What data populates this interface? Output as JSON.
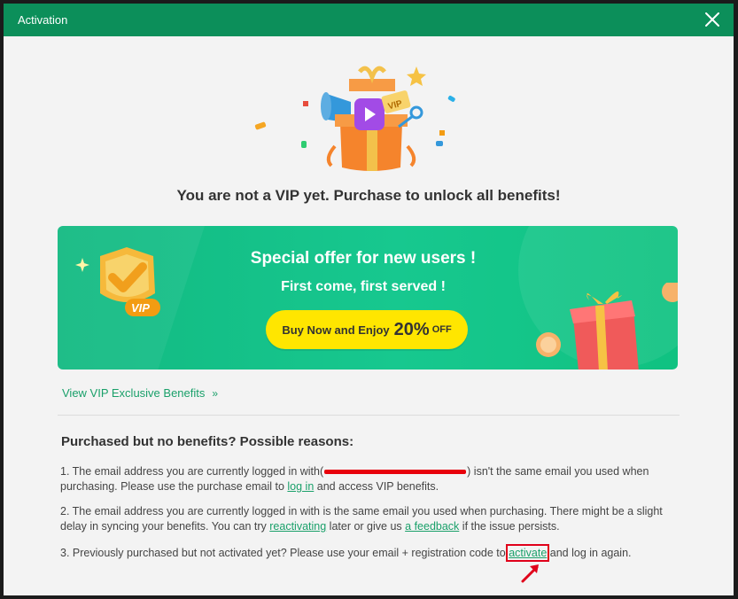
{
  "window": {
    "title": "Activation"
  },
  "headline": "You are not a VIP yet. Purchase to unlock all benefits!",
  "banner": {
    "title": "Special offer for new users !",
    "subtitle": "First come, first served !",
    "badge": "VIP",
    "button": {
      "prefix": "Buy Now and Enjoy",
      "percent": "20%",
      "suffix": "OFF"
    }
  },
  "vip_link": {
    "label": "View VIP Exclusive Benefits",
    "chevron": "»"
  },
  "reasons": {
    "title": "Purchased but no benefits? Possible reasons:",
    "r1": {
      "a": "1. The email address you are currently logged in with(",
      "b": ") isn't the same email you used when purchasing. Please use the purchase email to ",
      "link": "log in",
      "c": " and access VIP benefits."
    },
    "r2": {
      "a": "2. The email address you are currently logged in with is the same email you used when purchasing. There might be a slight delay in syncing your benefits. You can try ",
      "link1": "reactivating",
      "b": " later or give us ",
      "link2": "a feedback",
      "c": " if the issue persists."
    },
    "r3": {
      "a": "3. Previously purchased but not activated yet? Please use your email + registration code to ",
      "link": "activate",
      "b": " and log in again."
    }
  },
  "colors": {
    "titlebar": "#0c8f5a",
    "banner": "#17c88f",
    "button": "#ffe600",
    "link": "#1aa06a",
    "annotation": "#e0001a"
  },
  "icons": [
    "close-icon",
    "gift-hero-icon",
    "vip-crown-icon",
    "gift-box-icon",
    "chevron-right-icon",
    "arrow-annotation-icon"
  ]
}
